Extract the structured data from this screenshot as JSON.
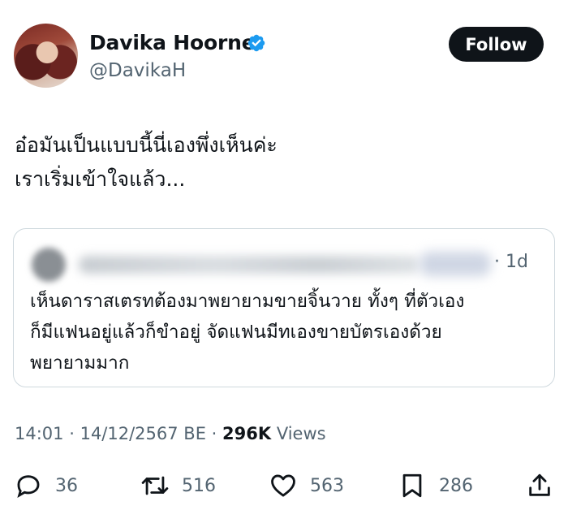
{
  "author": {
    "name": "Davika Hoorne",
    "handle": "@DavikaH",
    "follow_label": "Follow"
  },
  "tweet": {
    "lines": [
      "อ๋อมันเป็นแบบนี้นี่เองพึ่งเห็นค่ะ",
      "เราเริ่มเข้าใจแล้ว..."
    ]
  },
  "quote": {
    "time": "· 1d",
    "lines": [
      "เห็นดาราสเตรทต้องมาพยายามขายจิ้นวาย ทั้งๆ ที่ตัวเอง",
      "ก็มีแฟนอยู่แล้วก็ขำอยู่ จัดแฟนมีทเองขายบัตรเองด้วย",
      "พยายามมาก"
    ]
  },
  "meta": {
    "time": "14:01",
    "date": "14/12/2567 BE",
    "views_count": "296K",
    "views_label": "Views"
  },
  "actions": {
    "replies": "36",
    "reposts": "516",
    "likes": "563",
    "bookmarks": "286"
  },
  "colors": {
    "verified": "#1d9bf0",
    "text": "#0f1419",
    "secondary": "#536471"
  }
}
